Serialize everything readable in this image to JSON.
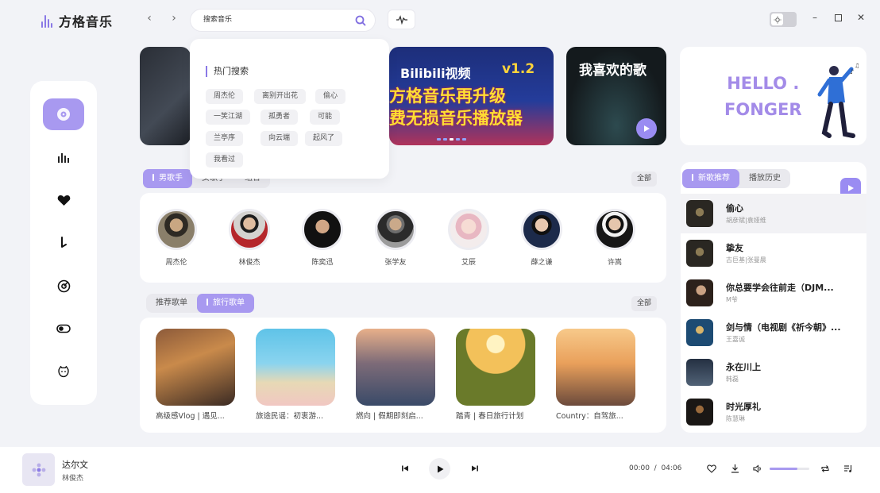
{
  "app": {
    "title": "方格音乐"
  },
  "search": {
    "value": "搜索音乐"
  },
  "hot_search": {
    "title": "热门搜索",
    "tags": [
      "周杰伦",
      "离别开出花",
      "偷心",
      "一笑江湖",
      "孤勇者",
      "可能",
      "兰亭序",
      "向云端",
      "起风了",
      "我看过"
    ]
  },
  "banners": {
    "promo_title": "Bilibili视频",
    "promo_version": "v1.2",
    "promo_line1": "方格音乐再升级",
    "promo_line2": "费无损音乐播放器",
    "fav_title": "我喜欢的歌",
    "hello_line1": "HELLO .",
    "hello_line2": "FONGER"
  },
  "singer_section": {
    "tabs": [
      "男歌手",
      "女歌手",
      "组合"
    ],
    "all_label": "全部",
    "singers": [
      "周杰伦",
      "林俊杰",
      "陈奕迅",
      "张学友",
      "艾辰",
      "薛之谦",
      "许嵩"
    ]
  },
  "playlist_section": {
    "tabs": [
      "推荐歌单",
      "旅行歌单"
    ],
    "all_label": "全部",
    "playlists": [
      "高级感Vlog | 遇见...",
      "旅途民谣：初衷游...",
      "燃向 | 假期即刻启...",
      "踏青 | 春日旅行计划",
      "Country：自驾旅..."
    ]
  },
  "right_panel": {
    "tabs": [
      "新歌推荐",
      "播放历史"
    ],
    "songs": [
      {
        "title": "偷心",
        "artist": "胡彦斌|袁娅维"
      },
      {
        "title": "挚友",
        "artist": "古巨基|张曼晨"
      },
      {
        "title": "你总要学会往前走（DJM...",
        "artist": "M爷"
      },
      {
        "title": "剑与情（电视剧《祈今朝》...",
        "artist": "王嘉诚"
      },
      {
        "title": "永在川上",
        "artist": "韩磊"
      },
      {
        "title": "时光厚礼",
        "artist": "陈慧琳"
      }
    ]
  },
  "player": {
    "title": "达尔文",
    "artist": "林俊杰",
    "current_time": "00:00",
    "separator": "/",
    "duration": "04:06",
    "volume": 0.7
  },
  "colors": {
    "accent": "#a899f0",
    "accent_dark": "#8a79e6",
    "background": "#f2f3f7"
  }
}
